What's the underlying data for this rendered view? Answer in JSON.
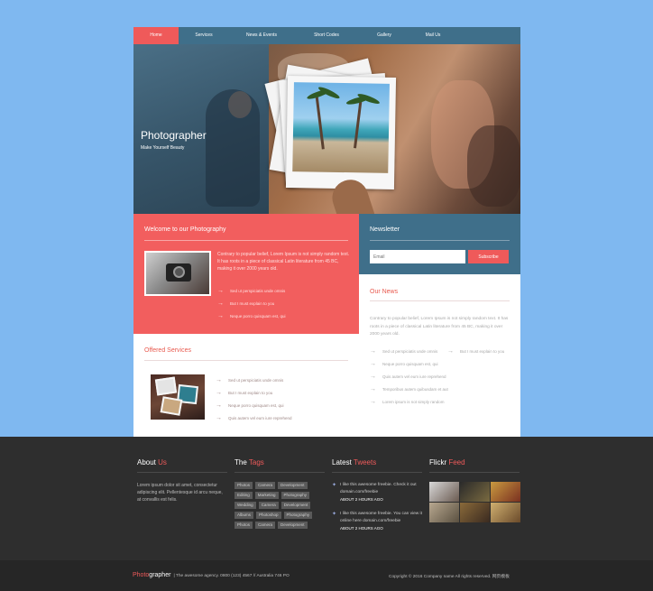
{
  "nav": {
    "items": [
      "Home",
      "Services",
      "News & Events",
      "Short Codes",
      "Gallery",
      "Mail Us"
    ],
    "active_index": 0
  },
  "hero": {
    "title": "Photographer",
    "subtitle": "Make Yourself Beauty",
    "slides": 3,
    "active_slide": 1
  },
  "welcome": {
    "title": "Welcome to our Photography",
    "text": "Contrary to popular belief, Lorem Ipsum is not simply random text. It has roots in a piece of classical Latin literature from 45 BC, making it over 2000 years old.",
    "items": [
      "Sed ut perspiciatis unde omnis",
      "But I must explain to you",
      "Neque porro quisquam est, qui"
    ]
  },
  "offered": {
    "title": "Offered Services",
    "items": [
      "Sed ut perspiciatis unde omnis",
      "But I must explain to you",
      "Neque porro quisquam est, qui",
      "Quis autem vel eum iure reprehend"
    ]
  },
  "newsletter": {
    "title": "Newsletter",
    "email_placeholder": "Email",
    "subscribe_label": "Subscribe"
  },
  "news": {
    "title": "Our News",
    "text": "Contrary to popular belief, Lorem Ipsum is not simply random text. It has roots in a piece of classical Latin literature from 45 BC, making it over 2000 years old.",
    "items": [
      "Sed ut perspiciatis unde omnis",
      "Neque porro quisquam est, qui",
      "Quis autem vel eum iure reprehend",
      "Temporibus autem quibusdam et aut",
      "Lorem ipsum is not simply random"
    ],
    "side_item": "But I must explain to you"
  },
  "footer": {
    "about": {
      "title_a": "About",
      "title_b": "Us",
      "text": "Lorem ipsum dolor sit amet, consectetur adipiscing elit. Pellentesque id arcu neque, at convallis est felis."
    },
    "tags": {
      "title_a": "The",
      "title_b": "Tags",
      "items": [
        "Photos",
        "Camera",
        "Development",
        "Editing",
        "Marketing",
        "Photography",
        "Wedding",
        "Camera",
        "Development",
        "Albums",
        "Photoshop",
        "Photography",
        "Photos",
        "Camera",
        "Development"
      ]
    },
    "tweets": {
      "title_a": "Latest",
      "title_b": "Tweets",
      "items": [
        {
          "text": "I like this awesome freebie. Check it out domain.com/freebie",
          "time": "ABOUT 2 HOURS AGO"
        },
        {
          "text": "I like this awesome freebie. You can view it online here domain.com/freebie",
          "time": "ABOUT 2 HOURS AGO"
        }
      ]
    },
    "flickr": {
      "title_a": "Flickr",
      "title_b": "Feed"
    }
  },
  "bottom": {
    "brand_a": "Photo",
    "brand_b": "grapher",
    "info": "| The awesome agency. 0800 (123) 4567 // Australia 746 PO",
    "copyright": "Copyright © 2016 Company name All rights reserved. 网页模板"
  },
  "colors": {
    "accent": "#ef5a5a",
    "blue": "#3f6f8a",
    "bg": "#7fb8f0",
    "footer": "#2e2e2e"
  }
}
